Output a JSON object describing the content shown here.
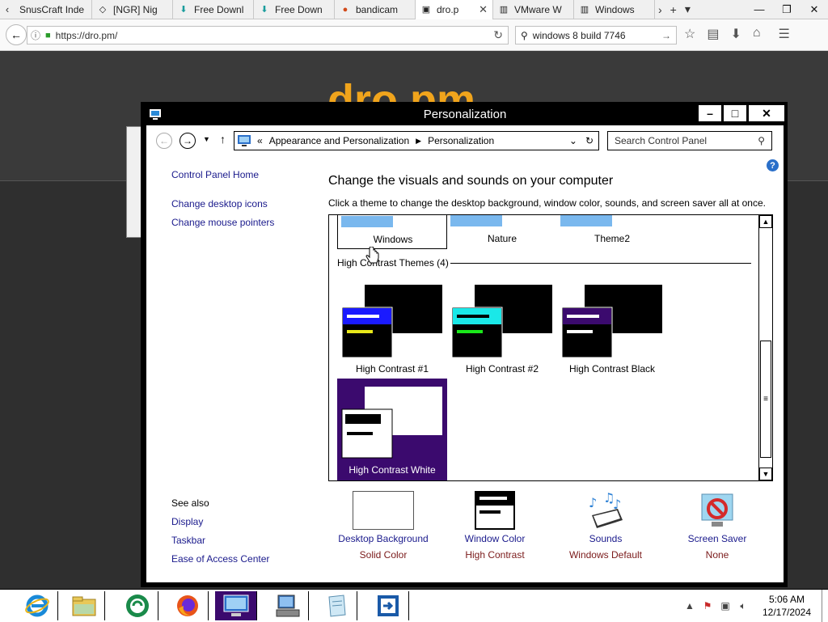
{
  "browser": {
    "tabs": [
      {
        "label": "SnusCraft Inde",
        "icon": "doc-icon"
      },
      {
        "label": "[NGR] Nig",
        "icon": "diamond-icon"
      },
      {
        "label": "Free Downl",
        "icon": "download-icon"
      },
      {
        "label": "Free Down",
        "icon": "download-icon"
      },
      {
        "label": "bandicam",
        "icon": "bandicam-icon"
      },
      {
        "label": "dro.p",
        "icon": "page-icon",
        "active": true
      },
      {
        "label": "VMware W",
        "icon": "doc-icon"
      },
      {
        "label": "Windows",
        "icon": "doc-icon"
      }
    ],
    "url": "https://dro.pm/",
    "search_value": "windows 8 build 7746"
  },
  "page": {
    "logo_text": "dro.pm"
  },
  "window": {
    "title": "Personalization",
    "address": {
      "prefix": "«",
      "crumbs": [
        "Appearance and Personalization",
        "Personalization"
      ]
    },
    "search_placeholder": "Search Control Panel",
    "left_links": {
      "home": "Control Panel Home",
      "desktop_icons": "Change desktop icons",
      "mouse_pointers": "Change mouse pointers"
    },
    "see_also": {
      "label": "See also",
      "display": "Display",
      "taskbar": "Taskbar",
      "ease": "Ease of Access Center"
    },
    "heading": "Change the visuals and sounds on your computer",
    "subheading": "Click a theme to change the desktop background, window color, sounds, and screen saver all at once.",
    "top_themes": [
      "Windows",
      "Nature",
      "Theme2"
    ],
    "group_label": "High Contrast Themes (4)",
    "hc_themes": [
      "High Contrast #1",
      "High Contrast #2",
      "High Contrast Black",
      "High Contrast White"
    ],
    "bottom": {
      "background": {
        "title": "Desktop Background",
        "value": "Solid Color"
      },
      "color": {
        "title": "Window Color",
        "value": "High Contrast"
      },
      "sounds": {
        "title": "Sounds",
        "value": "Windows Default"
      },
      "saver": {
        "title": "Screen Saver",
        "value": "None"
      }
    }
  },
  "taskbar": {
    "time": "5:06 AM",
    "date": "12/17/2024"
  },
  "colors": {
    "selected_theme": "#3b0a6e",
    "link": "#1a1a8c",
    "value_text": "#7a1a1a",
    "logo": "#f0a41c"
  }
}
